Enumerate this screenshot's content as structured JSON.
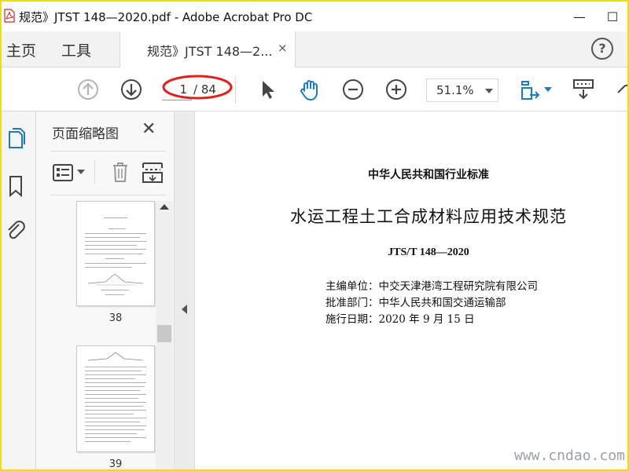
{
  "window": {
    "title": "规范》JTST 148—2020.pdf - Adobe Acrobat Pro DC",
    "minimize_glyph": "—",
    "maximize_glyph": "☐"
  },
  "tabs": {
    "home_label": "主页",
    "tools_label": "工具",
    "doc_tab_label": "规范》JTST 148—2...",
    "doc_tab_close": "×",
    "help_glyph": "?"
  },
  "toolbar": {
    "current_page": "1",
    "total_pages": "/ 84",
    "zoom": "51.1%",
    "annotation_color": "#e0201b",
    "accent_color": "#1a7dc2"
  },
  "left_rail": {
    "icons": [
      "page-thumbnails-icon",
      "bookmark-icon",
      "attachment-icon"
    ]
  },
  "thumbnail_panel": {
    "title": "页面缩略图",
    "close_glyph": "✕",
    "thumbnails": [
      {
        "label": "38"
      },
      {
        "label": "39"
      }
    ]
  },
  "document": {
    "header": "中华人民共和国行业标准",
    "title": "水运工程土工合成材料应用技术规范",
    "code": "JTS/T 148—2020",
    "lines": [
      "主编单位：中交天津港湾工程研究院有限公司",
      "批准部门：中华人民共和国交通运输部",
      "施行日期：2020 年 9 月 15 日"
    ]
  },
  "watermark": "www.cndao.com"
}
